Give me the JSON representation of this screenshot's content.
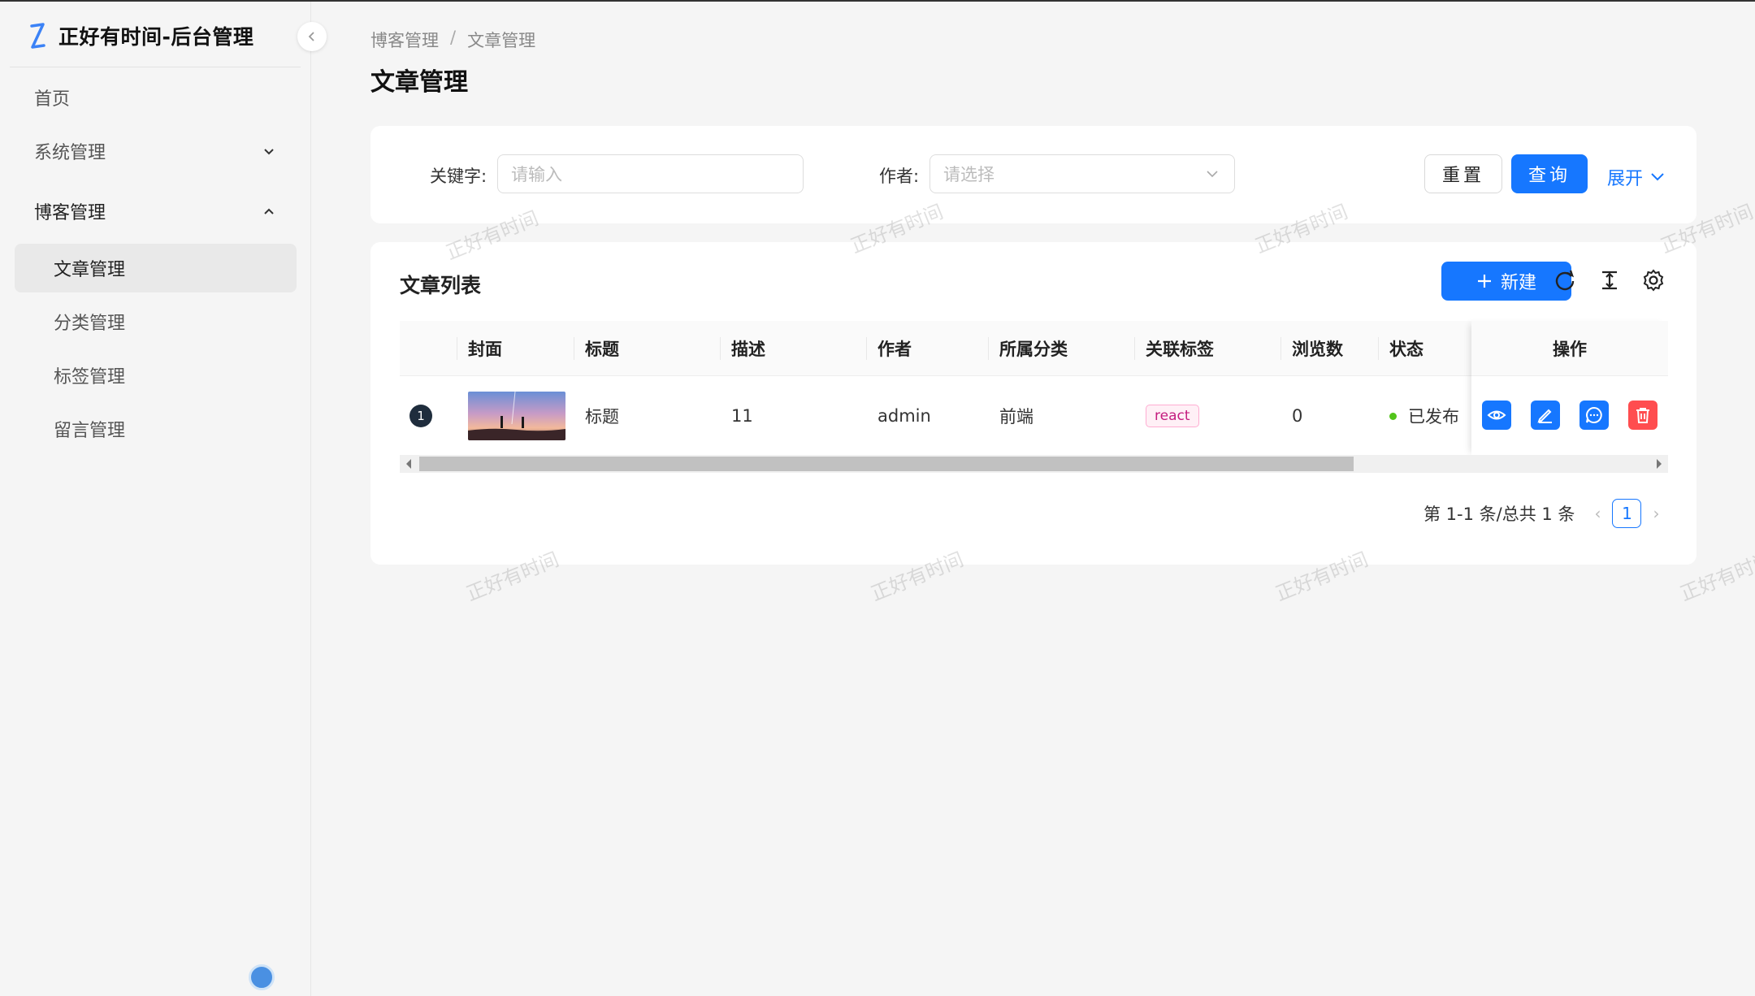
{
  "app": {
    "title": "正好有时间-后台管理"
  },
  "sidebar": {
    "items": [
      {
        "label": "首页"
      },
      {
        "label": "系统管理"
      },
      {
        "label": "博客管理"
      },
      {
        "label": "文章管理"
      },
      {
        "label": "分类管理"
      },
      {
        "label": "标签管理"
      },
      {
        "label": "留言管理"
      }
    ]
  },
  "breadcrumb": [
    "博客管理",
    "/",
    "文章管理"
  ],
  "page": {
    "title": "文章管理"
  },
  "filter": {
    "keyword_label": "关键字:",
    "keyword_placeholder": "请输入",
    "author_label": "作者:",
    "author_placeholder": "请选择",
    "reset_label": "重置",
    "query_label": "查询",
    "expand_label": "展开"
  },
  "list": {
    "title": "文章列表",
    "new_label": "新建",
    "columns": [
      "封面",
      "标题",
      "描述",
      "作者",
      "所属分类",
      "关联标签",
      "浏览数",
      "状态",
      "操作"
    ],
    "rows": [
      {
        "index": "1",
        "title": "标题",
        "desc": "11",
        "author": "admin",
        "category": "前端",
        "tag": "react",
        "views": "0",
        "status": "已发布"
      }
    ],
    "pagination": {
      "summary": "第 1-1 条/总共 1 条",
      "current": "1"
    }
  },
  "watermark": "正好有时间",
  "colors": {
    "primary": "#1677ff",
    "danger": "#ff4d4f",
    "success": "#52c41a",
    "tag_text": "#c41d7f"
  },
  "icons": [
    "logo-icon",
    "collapse-icon",
    "chevron-down-icon",
    "chevron-up-icon",
    "plus-icon",
    "reload-icon",
    "density-icon",
    "settings-icon",
    "eye-icon",
    "edit-icon",
    "comment-icon",
    "delete-icon"
  ]
}
